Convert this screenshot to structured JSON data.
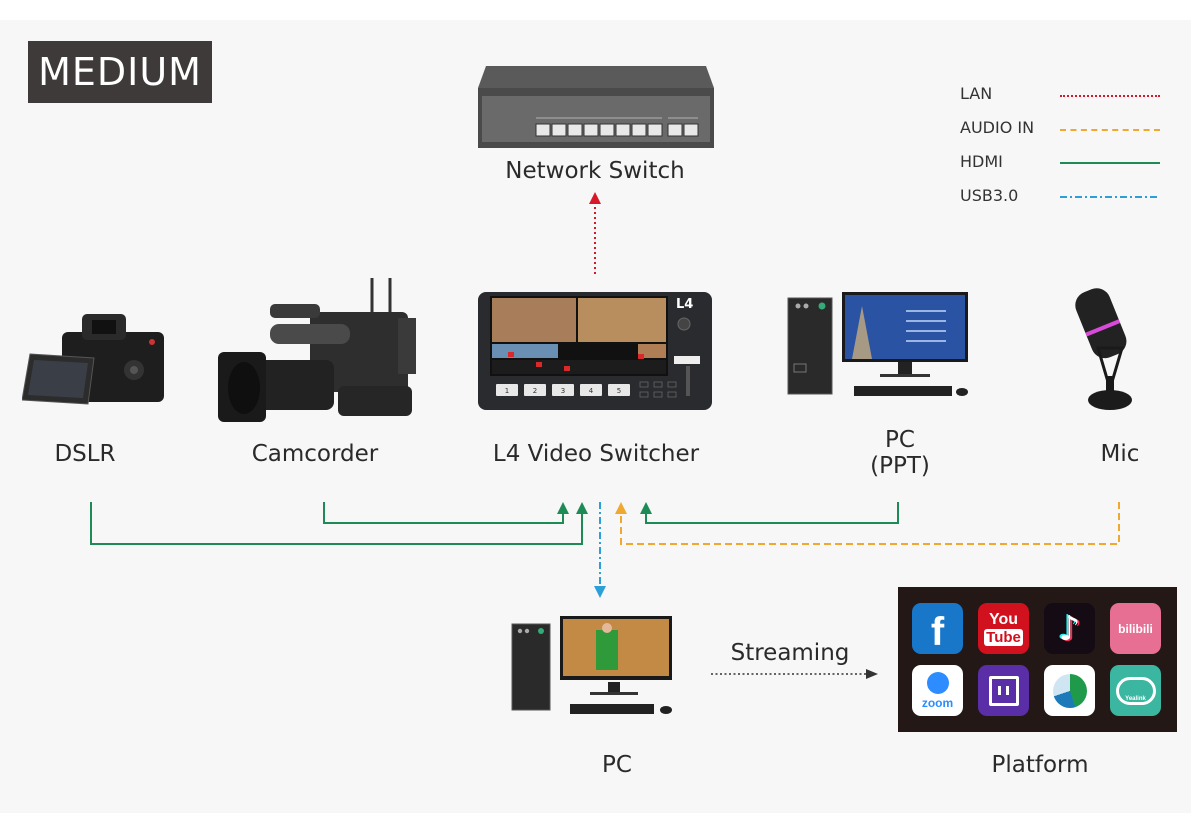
{
  "badge": "MEDIUM",
  "legend": [
    {
      "label": "LAN",
      "color": "#d7182a",
      "style": "dotted"
    },
    {
      "label": "AUDIO IN",
      "color": "#f0a830",
      "style": "dashed"
    },
    {
      "label": "HDMI",
      "color": "#1e8a55",
      "style": "solid"
    },
    {
      "label": "USB3.0",
      "color": "#2b9fd8",
      "style": "dash-dot"
    }
  ],
  "devices": {
    "network_switch": "Network Switch",
    "dslr": "DSLR",
    "camcorder": "Camcorder",
    "switcher": "L4 Video Switcher",
    "switcher_badge": "L4",
    "switcher_buttons": [
      "1",
      "2",
      "3",
      "4",
      "5"
    ],
    "pc_ppt_line1": "PC",
    "pc_ppt_line2": "(PPT)",
    "mic": "Mic",
    "pc": "PC",
    "platform": "Platform"
  },
  "streaming_label": "Streaming",
  "platforms": [
    {
      "name": "facebook",
      "glyph": "f",
      "bg": "#1877c9"
    },
    {
      "name": "youtube",
      "glyph": "You\nTube",
      "bg": "#d2111f"
    },
    {
      "name": "tiktok",
      "glyph": "♪",
      "bg": "#150b14"
    },
    {
      "name": "bilibili",
      "glyph": "bilibili",
      "bg": "#e66f93"
    },
    {
      "name": "zoom",
      "glyph": "zoom",
      "bg": "#ffffff"
    },
    {
      "name": "twitch",
      "glyph": "▮▮",
      "bg": "#5a2ea6"
    },
    {
      "name": "webex",
      "glyph": "◐",
      "bg": "#ffffff"
    },
    {
      "name": "yealink",
      "glyph": "Yealink",
      "bg": "#3bb6a0"
    }
  ]
}
